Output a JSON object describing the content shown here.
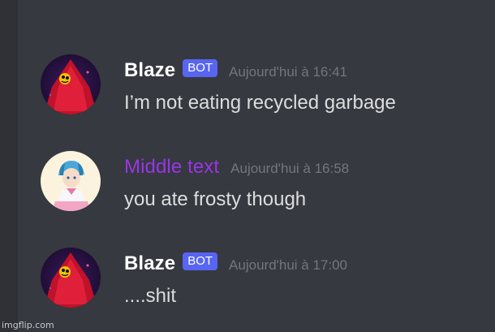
{
  "messages": [
    {
      "username": "Blaze",
      "badge": "BOT",
      "timestamp": "Aujourd'hui à 16:41",
      "content": "I’m not eating recycled garbage",
      "avatar": "red-creature-avatar"
    },
    {
      "username": "Middle text",
      "timestamp": "Aujourd'hui à 16:58",
      "content": "you ate frosty though",
      "avatar": "anime-character-avatar",
      "name_color": "#9b34e8"
    },
    {
      "username": "Blaze",
      "badge": "BOT",
      "timestamp": "Aujourd'hui à 17:00",
      "content": "....shit",
      "avatar": "red-creature-avatar"
    }
  ],
  "colors": {
    "background": "#36393f",
    "bot_badge": "#5865f2",
    "timestamp": "#72767d",
    "message_text": "#dcddde"
  },
  "watermark": "imgflip.com"
}
